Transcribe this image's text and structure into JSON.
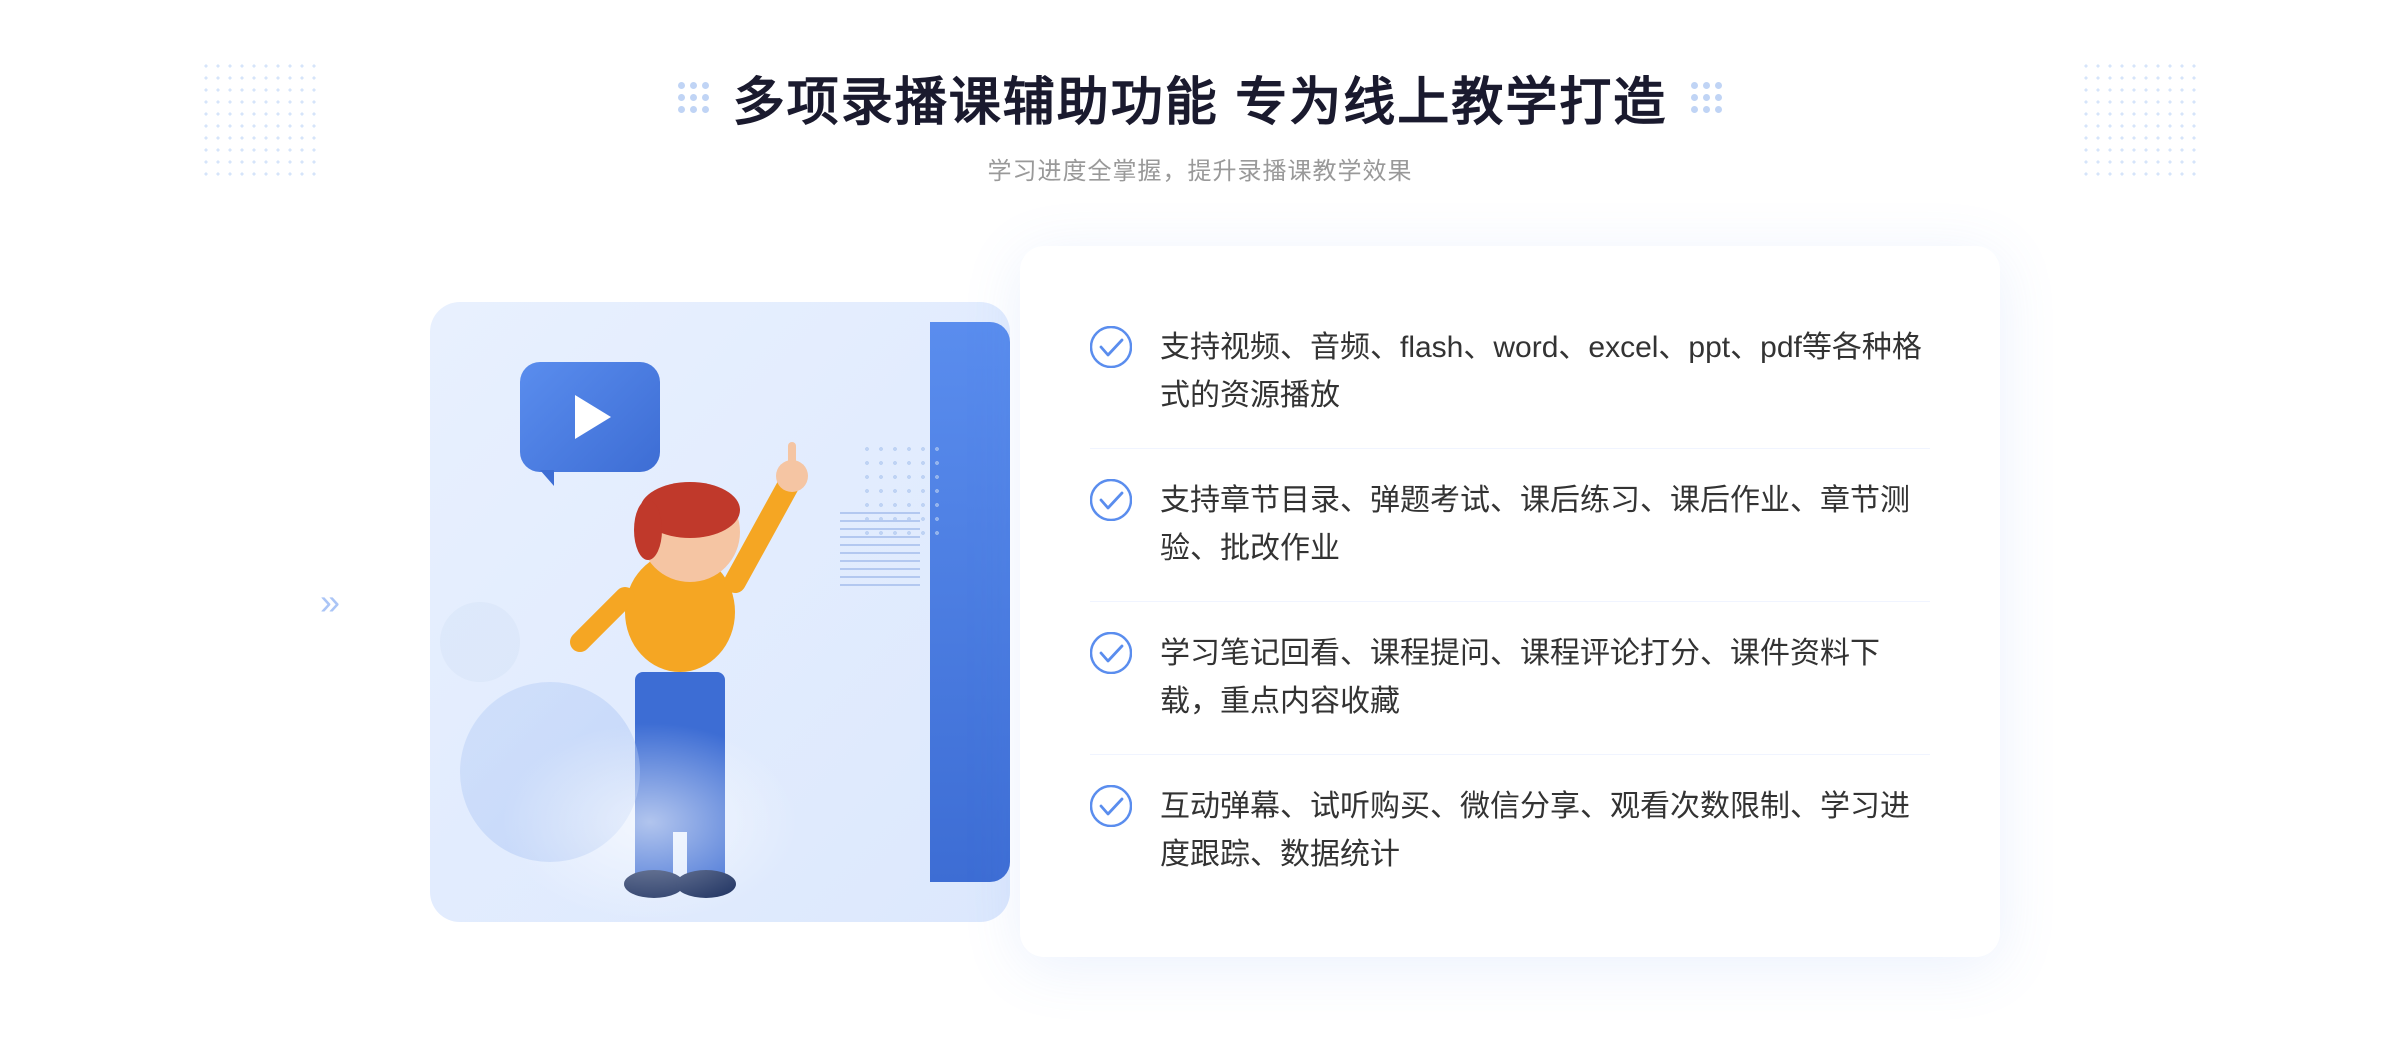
{
  "page": {
    "title": "多项录播课辅助功能 专为线上教学打造",
    "subtitle": "学习进度全掌握，提升录播课教学效果",
    "features": [
      {
        "id": "feature-1",
        "text": "支持视频、音频、flash、word、excel、ppt、pdf等各种格式的资源播放"
      },
      {
        "id": "feature-2",
        "text": "支持章节目录、弹题考试、课后练习、课后作业、章节测验、批改作业"
      },
      {
        "id": "feature-3",
        "text": "学习笔记回看、课程提问、课程评论打分、课件资料下载，重点内容收藏"
      },
      {
        "id": "feature-4",
        "text": "互动弹幕、试听购买、微信分享、观看次数限制、学习进度跟踪、数据统计"
      }
    ],
    "colors": {
      "primary_blue": "#5a8dee",
      "dark_blue": "#3d6dd4",
      "light_blue_bg": "#e8f0fe",
      "text_dark": "#1a1a2e",
      "text_gray": "#999999",
      "feature_text": "#333333"
    },
    "icons": {
      "check": "check-circle-icon",
      "play": "play-icon",
      "chevrons": "chevrons-right-icon"
    }
  }
}
